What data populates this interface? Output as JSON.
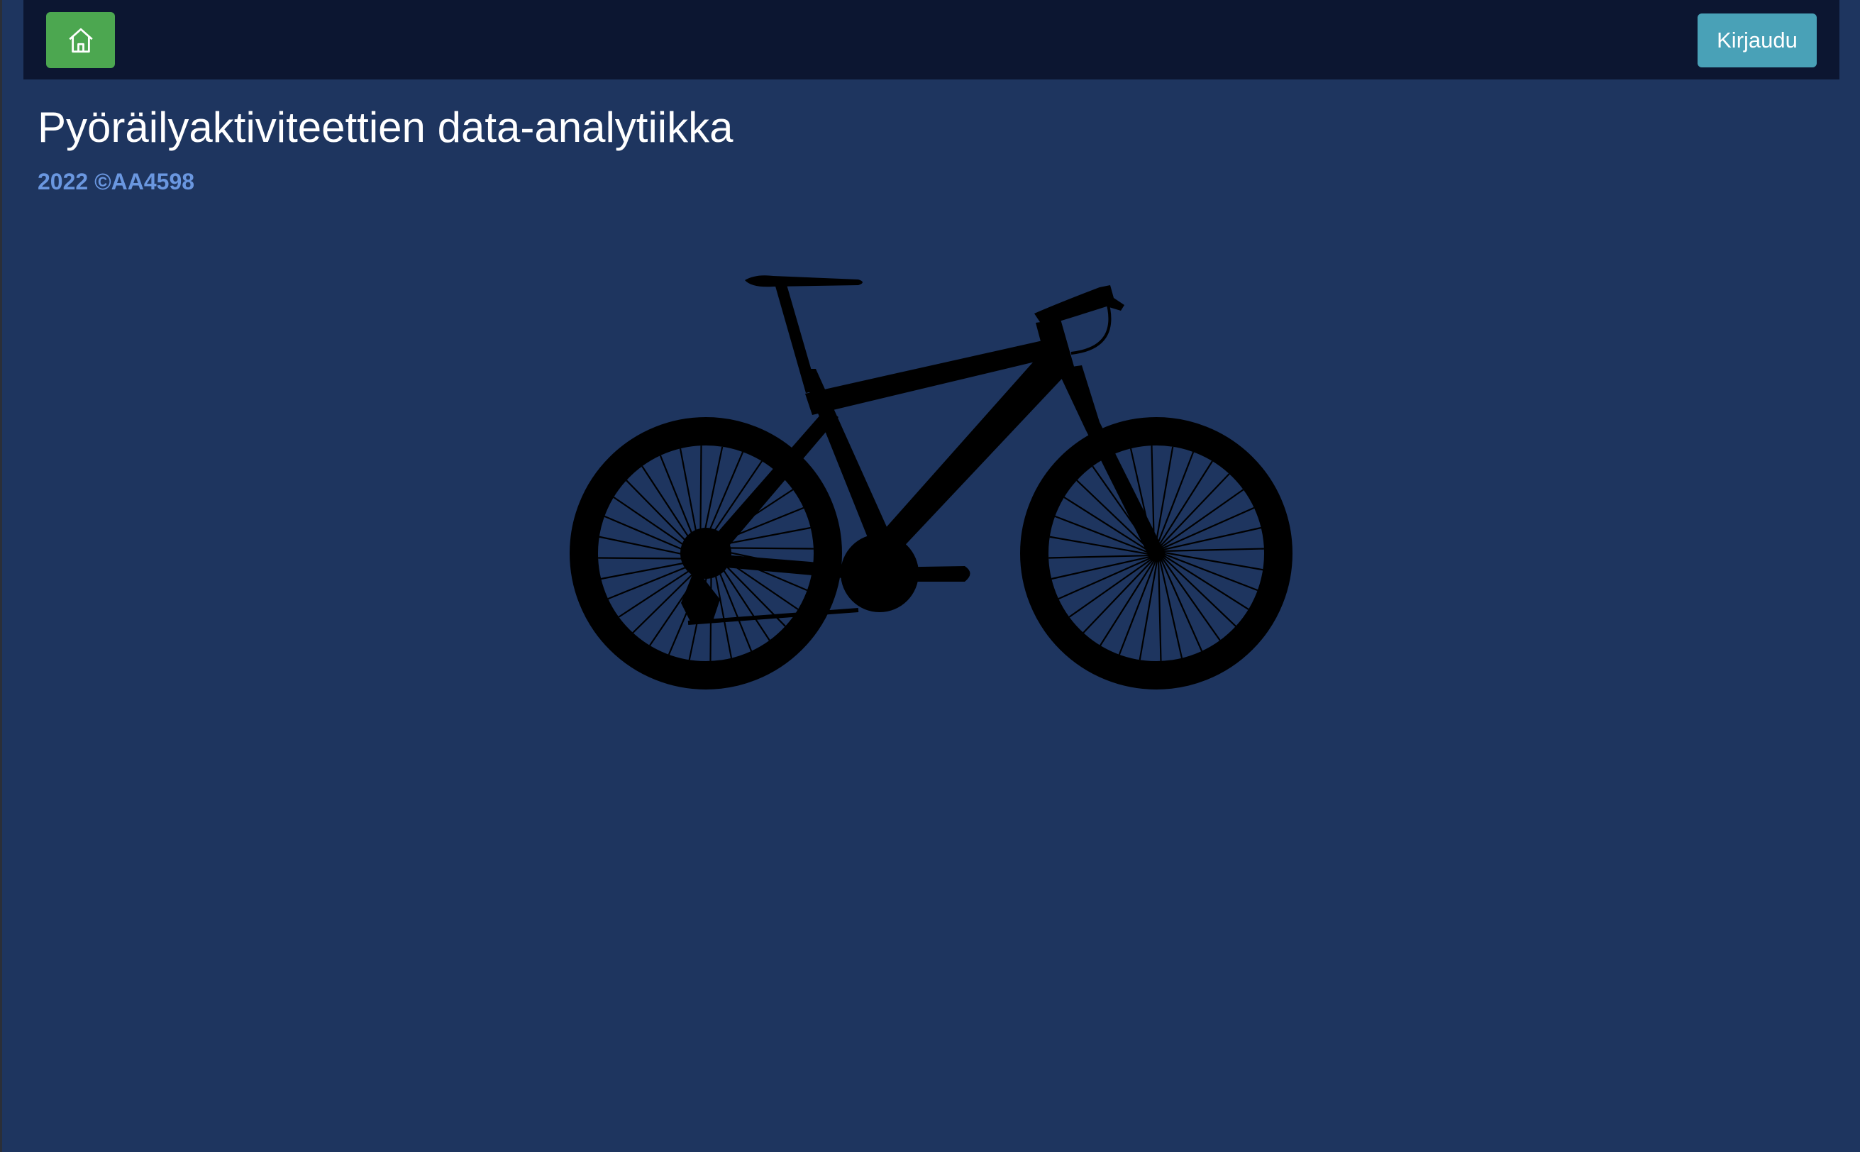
{
  "navbar": {
    "home_icon": "home-icon",
    "login_label": "Kirjaudu"
  },
  "main": {
    "title": "Pyöräilyaktiviteettien data-analytiikka",
    "copyright": "2022 ©AA4598",
    "hero_image": "bicycle-silhouette"
  },
  "colors": {
    "background": "#1e355f",
    "navbar": "#0c1631",
    "home_button": "#4ca750",
    "login_button": "#49a1b7",
    "copyright_text": "#6a97e0"
  }
}
